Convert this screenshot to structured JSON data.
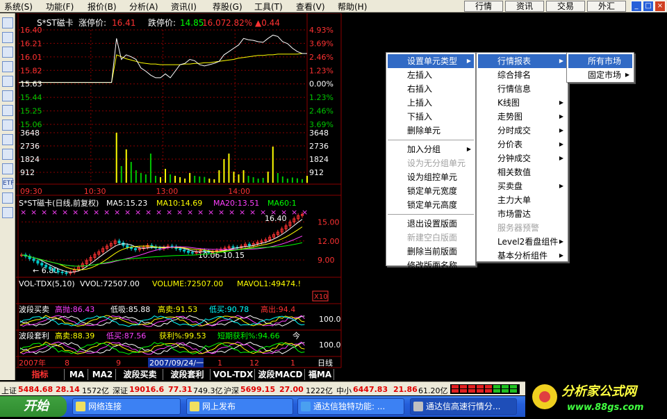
{
  "menubar": {
    "items": [
      "系统(S)",
      "功能(F)",
      "报价(B)",
      "分析(A)",
      "资讯(I)",
      "荐股(G)",
      "工具(T)",
      "查看(V)",
      "帮助(H)"
    ],
    "quick_buttons": [
      "行情",
      "资讯",
      "交易",
      "外汇"
    ],
    "window_buttons": [
      "_",
      "□",
      "×"
    ]
  },
  "toolbar": {
    "icons": [
      "quote-list-icon",
      "grid-icon",
      "trend-icon",
      "kline-icon",
      "report-icon",
      "table-icon",
      "finance-icon",
      "info-icon",
      "people-icon",
      "funds-icon",
      "search-icon",
      "etf-icon",
      "tool-icon",
      "formula-icon"
    ],
    "labels": [
      "",
      "",
      "",
      "",
      "",
      "",
      "",
      "",
      "",
      "",
      "",
      "ETF",
      "",
      ""
    ]
  },
  "intraday": {
    "title": "S*ST磁卡",
    "limit_up_label": "涨停价:",
    "limit_up": "16.41",
    "limit_down_label": "跌停价:",
    "limit_down": "14.85",
    "last": "16.07",
    "change_pct": "2.82%",
    "change": "▲0.44",
    "price_ticks": [
      "16.40",
      "16.21",
      "16.01",
      "15.82",
      "15.63",
      "15.44",
      "15.25",
      "15.06"
    ],
    "pct_ticks": [
      "4.93%",
      "3.69%",
      "2.46%",
      "1.23%",
      "0.00%",
      "1.23%",
      "2.46%",
      "3.69%"
    ],
    "vol_ticks": [
      "3648",
      "2736",
      "1824",
      "912"
    ],
    "time_ticks": [
      "09:30",
      "10:30",
      "13:00",
      "14:00"
    ],
    "base_price": 15.63,
    "y_max": 16.43,
    "y_min": 14.99,
    "vol_max": 4000,
    "price_series": [
      15.63,
      15.63,
      15.63,
      15.63,
      15.63,
      15.63,
      15.63,
      15.63,
      15.63,
      15.63,
      15.63,
      15.63,
      15.63,
      15.63,
      15.63,
      15.63,
      15.63,
      15.63,
      15.63,
      15.63,
      16.3,
      15.98,
      16.05,
      16.02,
      15.98,
      15.85,
      15.8,
      15.74,
      15.7,
      15.7,
      15.76,
      15.7,
      15.8,
      15.9,
      15.92,
      15.98,
      15.96,
      15.9,
      15.88,
      15.9,
      15.92,
      15.95,
      16.05,
      16.1,
      16.15,
      16.2,
      16.3,
      16.28,
      16.27,
      16.25,
      16.24,
      16.3,
      16.35,
      16.33,
      16.25,
      16.22,
      16.15,
      16.1,
      16.07,
      16.07
    ],
    "avg_series": [
      15.63,
      15.63,
      15.63,
      15.63,
      15.63,
      15.63,
      15.63,
      15.63,
      15.63,
      15.63,
      15.63,
      15.63,
      15.63,
      15.63,
      15.63,
      15.63,
      15.63,
      15.63,
      15.63,
      15.63,
      16.05,
      16.02,
      15.99,
      15.97,
      15.95,
      15.93,
      15.92,
      15.91,
      15.91,
      15.9,
      15.9,
      15.9,
      15.9,
      15.9,
      15.91,
      15.91,
      15.92,
      15.92,
      15.93,
      15.93,
      15.94,
      15.95,
      15.96,
      15.97,
      15.98,
      16.0,
      16.01,
      16.02,
      16.03,
      16.04,
      16.04,
      16.05,
      16.05,
      16.06,
      16.06,
      16.06,
      16.06,
      16.06,
      16.07,
      16.07
    ],
    "vol_series": [
      0,
      0,
      0,
      0,
      0,
      0,
      0,
      0,
      0,
      0,
      0,
      0,
      0,
      0,
      0,
      0,
      0,
      0,
      0,
      0,
      3600,
      1200,
      2400,
      1500,
      900,
      700,
      600,
      2100,
      500,
      400,
      1000,
      600,
      500,
      400,
      300,
      700,
      500,
      450,
      420,
      300,
      250,
      900,
      1700,
      2100,
      800,
      600,
      900,
      500,
      400,
      300,
      350,
      800,
      2600,
      700,
      450,
      300,
      380,
      320,
      260,
      500
    ]
  },
  "kline": {
    "title": "S*ST磁卡(日线,前复权)",
    "ma5": "MA5:15.23",
    "ma10": "MA10:14.69",
    "ma20": "MA20:13.51",
    "ma60": "MA60:1",
    "high_label": "16.40",
    "low_label": "← 6.80",
    "range_label": "10.06-10.15",
    "y_ticks": [
      "15.00",
      "12.00",
      "9.00"
    ],
    "y_min": 6.5,
    "y_max": 16.8,
    "closes": [
      9.8,
      9.6,
      9.2,
      8.9,
      8.5,
      8.2,
      7.9,
      7.6,
      7.3,
      7.1,
      7.0,
      6.9,
      7.1,
      7.5,
      7.9,
      8.4,
      8.9,
      9.4,
      9.9,
      10.3,
      10.8,
      11.2,
      11.6,
      12.0,
      11.7,
      11.3,
      11.0,
      10.8,
      10.6,
      10.8,
      11.0,
      11.3,
      11.1,
      10.9,
      10.8,
      11.0,
      11.2,
      11.1,
      10.8,
      10.6,
      10.4,
      10.2,
      10.1,
      10.3,
      10.5,
      10.4,
      10.2,
      10.3,
      10.5,
      10.7,
      10.9,
      11.1,
      11.0,
      10.9,
      11.2,
      11.5,
      11.3,
      11.6,
      11.8,
      12.0,
      12.2,
      12.6,
      13.0,
      13.4,
      13.9,
      14.4,
      15.0,
      15.5,
      16.0,
      16.2
    ]
  },
  "volume": {
    "title": "VOL-TDX(5,10)",
    "vvol": "VVOL:72507.00",
    "volume": "VOLUME:72507.00",
    "mavol1": "MAVOL1:49474.!",
    "x_label": "X10"
  },
  "indicator1": {
    "name": "波段买卖",
    "l1": "高抛:86.43",
    "l2": "低吸:85.88",
    "l3": "高卖:91.53",
    "l4": "低买:90.78",
    "l5": "高出:94.4",
    "tick": "100.0"
  },
  "indicator2": {
    "name": "波段套利",
    "l1": "高卖:88.39",
    "l2": "低买:87.56",
    "l3": "获利%:99.53",
    "l4": "短期获利%:94.66",
    "l5": "今",
    "tick": "100.0"
  },
  "date_axis": {
    "year": "2007年",
    "m8": "8",
    "m9": "9",
    "cursor": "2007/09/24/一",
    "m11": "1",
    "m12": "12",
    "m1": "1",
    "period": "日线"
  },
  "tabs": [
    "指标",
    "MA",
    "MA2",
    "波段买卖",
    "波段套利",
    "VOL-TDX",
    "波段MACD",
    "福MA"
  ],
  "context_menu": {
    "main": [
      {
        "label": "设置单元类型",
        "arrow": true,
        "hl": true
      },
      {
        "label": "左插入"
      },
      {
        "label": "右插入"
      },
      {
        "label": "上插入"
      },
      {
        "label": "下插入"
      },
      {
        "label": "删除单元"
      },
      {
        "sep": true
      },
      {
        "label": "加入分组",
        "arrow": true
      },
      {
        "label": "设为无分组单元",
        "dis": true
      },
      {
        "label": "设为组控单元"
      },
      {
        "label": "锁定单元宽度"
      },
      {
        "label": "锁定单元高度"
      },
      {
        "sep": true
      },
      {
        "label": "退出设置版面"
      },
      {
        "label": "新建空白版面",
        "dis": true
      },
      {
        "label": "删除当前版面"
      },
      {
        "label": "修改版面名称"
      }
    ],
    "sub1": [
      {
        "label": "行情报表",
        "arrow": true,
        "hl": true
      },
      {
        "label": "综合排名"
      },
      {
        "label": "行情信息"
      },
      {
        "label": "K线图",
        "arrow": true
      },
      {
        "label": "走势图",
        "arrow": true
      },
      {
        "label": "分时成交",
        "arrow": true
      },
      {
        "label": "分价表",
        "arrow": true
      },
      {
        "label": "分钟成交",
        "arrow": true
      },
      {
        "label": "相关数值"
      },
      {
        "label": "买卖盘",
        "arrow": true
      },
      {
        "label": "主力大单"
      },
      {
        "label": "市场雷达"
      },
      {
        "label": "服务器预警",
        "dis": true
      },
      {
        "label": "Level2看盘组件",
        "arrow": true
      },
      {
        "label": "基本分析组件",
        "arrow": true
      }
    ],
    "sub2": [
      {
        "label": "所有市场",
        "hl": true
      },
      {
        "label": "固定市场",
        "arrow": true
      }
    ]
  },
  "statusbar": {
    "sh_label": "上证",
    "sh_index": "5484.68",
    "sh_change": "28.14",
    "sh_amount": "1572亿",
    "sz_label": "深证",
    "sz_index": "19016.6",
    "sz_change": "77.31",
    "sz_amount": "749.3亿",
    "hs_label": "沪深",
    "hs_index": "5699.15",
    "hs_change": "27.00",
    "hs_amount": "1222亿",
    "zx_label": "中小",
    "zx_index": "6447.83",
    "zx_change": "21.86",
    "zx_amount": "61.20亿"
  },
  "taskbar": {
    "start": "开始",
    "tasks": [
      "网络连接",
      "网上发布",
      "通达信独特功能: ...",
      "通达信高速行情分..."
    ]
  },
  "brand": {
    "name": "分析家公式网",
    "url": "www.88gs.com"
  },
  "colors": {
    "grid": "#8b0000",
    "up": "#ff3232",
    "down": "#00c8c8",
    "price": "#ffffff",
    "avg": "#ffff00",
    "vol": "#00ff00",
    "menu_hl": "#316ac5"
  }
}
